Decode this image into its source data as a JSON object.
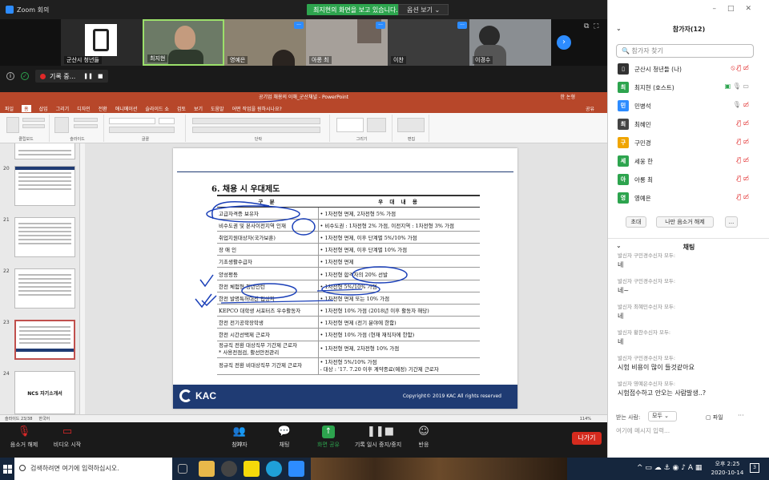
{
  "window": {
    "title": "Zoom 회의",
    "share_banner": "최지현의 화면을 보고 있습니다.",
    "view_options": "옵션 보기 ⌄"
  },
  "video_strip": [
    {
      "name": "군산시 청년들",
      "type": "logo"
    },
    {
      "name": "최지현",
      "type": "person",
      "active": true
    },
    {
      "name": "영예은",
      "type": "person"
    },
    {
      "name": "아롱 최",
      "type": "person"
    },
    {
      "name": "이찬",
      "type": "person"
    },
    {
      "name": "이경수",
      "type": "person"
    }
  ],
  "recording": {
    "label": "기록 중..."
  },
  "ppt": {
    "title_bar": "공기업 채용의 이해_군산채널 - PowerPoint",
    "user": "한 논형",
    "tabs": [
      "파일",
      "홈",
      "삽입",
      "그리기",
      "디자인",
      "전환",
      "애니메이션",
      "슬라이드 쇼",
      "검토",
      "보기",
      "도움말",
      "어떤 작업을 원하시나요?"
    ],
    "active_tab": "홈",
    "ribbon_groups": [
      "클립보드",
      "슬라이드",
      "글꼴",
      "단락",
      "그리기",
      "편집"
    ],
    "share_label": "공유",
    "slide_numbers": [
      "20",
      "21",
      "22",
      "23",
      "24"
    ],
    "slide24_title": "NCS 자기소개서",
    "status_left": "슬라이드 23/38",
    "status_lang": "한국어",
    "status_zoom": "114%"
  },
  "slide": {
    "heading": "6. 채용 시 우대제도",
    "col1_header": "구 분",
    "col2_header": "우 대 내 용",
    "rows": [
      [
        "고급자격증 보유자",
        "• 1차전형 면제, 2차전형 5% 가점"
      ],
      [
        "비수도권 및 본사이전지역 인재",
        "• 비수도권 : 1차전형 2% 가점, 이전지역 : 1차전형 3% 가점"
      ],
      [
        "취업지원대상자(국가보훈)",
        "• 1차전형 면제, 이후 단계별 5%/10% 가점"
      ],
      [
        "장 애 인",
        "• 1차전형 면제, 이후 단계별 10% 가점"
      ],
      [
        "기초생활수급자",
        "• 1차전형 면제"
      ],
      [
        "양성평등",
        "• 1차전형 합격자의 20% 선발"
      ],
      [
        "한전 체험형 청년인턴",
        "• 1차전형 5%/10% 가점"
      ],
      [
        "한전 발명특허대전 입상자",
        "• 1차전형 면제 또는 10% 가점"
      ],
      [
        "KEPCO 대학생 서포터즈 우수활동자",
        "• 1차전형 10% 가점 (2018년 이후 활동자 해당)"
      ],
      [
        "한전 전기공학장학생",
        "• 1차전형 면제 (전기 분야에 한함)"
      ],
      [
        "한전 시간선택제 근로자",
        "• 1차전형 10% 가점 (현재 재직자에 한함)"
      ],
      [
        "정규직 전환 대상직무 기간제 근로자\n* 사용전점검, 활선안전관리",
        "• 1차전형 면제, 2차전형 10% 가점"
      ],
      [
        "정규직 전환 비대상직무 기간제 근로자",
        "• 1차전형 5%/10% 가점\n- 대상 : '17. 7.20 이후 계약종료(예정) 기간제 근로자"
      ]
    ],
    "logo": "KAC",
    "copyright": "Copyright© 2019 KAC All rights reserved"
  },
  "toolbar": {
    "mute": "음소거 해제",
    "video": "비디오 시작",
    "participants": "참가자",
    "participants_count": "12",
    "chat": "채팅",
    "share": "화면 공유",
    "pause_record": "기록 일시 중지/중지",
    "reactions": "반응",
    "end": "나가기"
  },
  "participants_panel": {
    "title": "참가자(12)",
    "search_placeholder": "참가자 찾기",
    "list": [
      {
        "name": "군산시 청년들 (나)",
        "initial": "",
        "color": "#333333"
      },
      {
        "name": "최지현 (호스트)",
        "initial": "최",
        "color": "#2da44e"
      },
      {
        "name": "민병석",
        "initial": "민",
        "color": "#2d8cff"
      },
      {
        "name": "최혜민",
        "initial": "최",
        "color": "#444444"
      },
      {
        "name": "구민경",
        "initial": "구",
        "color": "#f0a500"
      },
      {
        "name": "세웅 한",
        "initial": "세",
        "color": "#2da44e"
      },
      {
        "name": "아롱 최",
        "initial": "아",
        "color": "#2da44e"
      },
      {
        "name": "영예은",
        "initial": "영",
        "color": "#2da44e"
      }
    ],
    "invite": "초대",
    "unmute_me": "나만 음소거 해제",
    "more": "..."
  },
  "chat": {
    "title": "채팅",
    "messages": [
      {
        "from": "발신자 구민경수신자 모두:",
        "text": "네"
      },
      {
        "from": "발신자 구민경수신자 모두:",
        "text": "네~"
      },
      {
        "from": "발신자 최혜민수신자 모두:",
        "text": "네"
      },
      {
        "from": "발신자 황찬수신자 모두:",
        "text": "네"
      },
      {
        "from": "발신자 구민경수신자 모두:",
        "text": "시험 비용이 많이 들것같아요"
      },
      {
        "from": "발신자 영예은수신자 모두:",
        "text": "시험접수하고 안오는 사람발생..?"
      }
    ],
    "to_label": "받는 사람:",
    "to_value": "모두 ⌄",
    "file": "파일",
    "input_placeholder": "여기에 메시지 입력..."
  },
  "taskbar": {
    "search_placeholder": "검색하려면 여기에 입력하십시오.",
    "time": "오후 2:25",
    "date": "2020-10-14",
    "notifications": "3"
  }
}
